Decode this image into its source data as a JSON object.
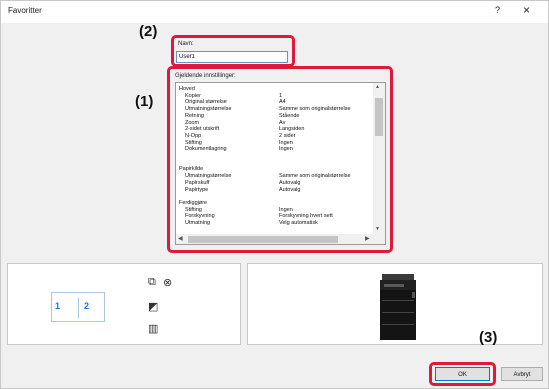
{
  "window": {
    "title": "Favoritter",
    "help_glyph": "?",
    "close_glyph": "×"
  },
  "callouts": {
    "c1": "(1)",
    "c2": "(2)",
    "c3": "(3)"
  },
  "name_field": {
    "label": "Navn:",
    "value": "User1"
  },
  "settings": {
    "label": "Gjeldende innstillinger:",
    "rows": [
      {
        "key": "Hoved",
        "value": ""
      },
      {
        "key": "Kopier",
        "value": "1"
      },
      {
        "key": "Original størrelse",
        "value": "A4"
      },
      {
        "key": "Utmatningstørrelse",
        "value": "Samme som originalstørrelse"
      },
      {
        "key": "Retning",
        "value": "Stående"
      },
      {
        "key": "Zoom",
        "value": "Av"
      },
      {
        "key": "2-sidet utskrift",
        "value": "Langsiden"
      },
      {
        "key": "N-Opp",
        "value": "2 sider"
      },
      {
        "key": "Stifting",
        "value": "Ingen"
      },
      {
        "key": "Dokumentlagring",
        "value": "Ingen"
      },
      {
        "key": "",
        "value": ""
      },
      {
        "key": "",
        "value": ""
      },
      {
        "key": "Papirkilde",
        "value": ""
      },
      {
        "key": "Utmatningstørrelse",
        "value": "Samme som originalstørrelse"
      },
      {
        "key": "Papirskuff",
        "value": "Autovalg"
      },
      {
        "key": "Papirtype",
        "value": "Autovalg"
      },
      {
        "key": "",
        "value": ""
      },
      {
        "key": "Ferdiggjøre",
        "value": ""
      },
      {
        "key": "Stifting",
        "value": "Ingen"
      },
      {
        "key": "Forskyvning",
        "value": "Forskyvning hvert sett"
      },
      {
        "key": "Utmatning",
        "value": "Velg automatisk"
      }
    ]
  },
  "preview": {
    "page_1": "1",
    "page_2": "2"
  },
  "buttons": {
    "ok": "OK",
    "cancel": "Avbryt"
  },
  "colors": {
    "highlight": "#e0193c",
    "accent": "#1a73e8"
  },
  "icons": [
    "copies-icon",
    "staple-icon",
    "color-mode-icon",
    "document-icon",
    "printer-image"
  ]
}
